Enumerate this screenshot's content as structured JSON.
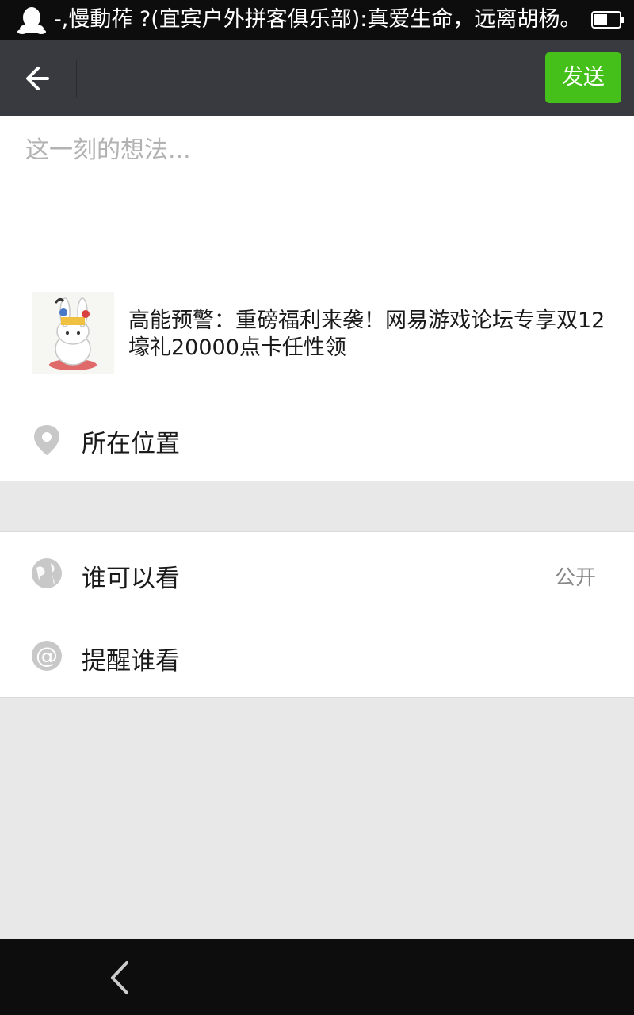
{
  "status_bar": {
    "notification_text": "-,慢動莋 ?(宜宾户外拼客俱乐部):真爱生命，远离胡杨。",
    "left_icon": "qq-penguin-icon",
    "right_icon": "battery-icon"
  },
  "header": {
    "back_icon": "back-arrow-icon",
    "send_label": "发送"
  },
  "compose": {
    "placeholder": "这一刻的想法...",
    "shared_link": {
      "thumbnail_icon": "rabbit-thumbnail",
      "title": "高能预警：重磅福利来袭！网易游戏论坛专享双12壕礼20000点卡任性领"
    }
  },
  "location": {
    "icon": "location-pin-icon",
    "label": "所在位置"
  },
  "visibility": {
    "who_can_see": {
      "icon": "globe-icon",
      "label": "谁可以看",
      "value": "公开"
    },
    "remind": {
      "icon": "at-sign-icon",
      "label": "提醒谁看"
    }
  },
  "nav": {
    "back_icon": "nav-back-icon"
  },
  "colors": {
    "header_bg": "#393a3f",
    "send_button": "#45c01a",
    "page_bg": "#e8e8e8"
  }
}
